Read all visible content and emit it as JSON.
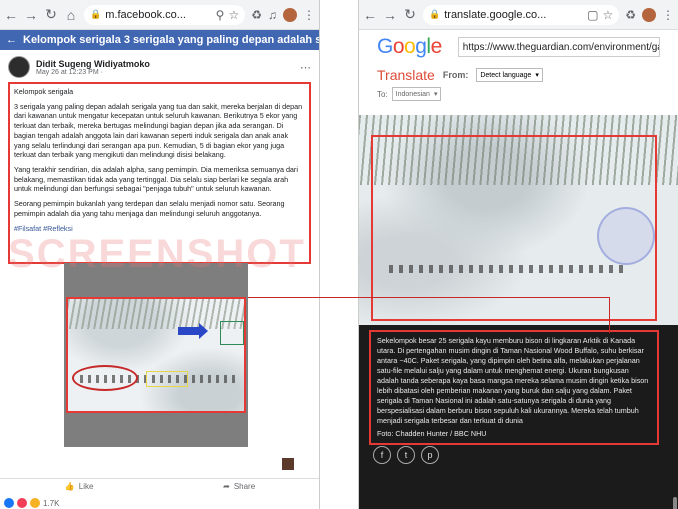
{
  "left": {
    "url": "m.facebook.co...",
    "page_title": "Kelompok serigala 3 serigala yang paling depan adalah ser...",
    "author": "Didit Sugeng Widiyatmoko",
    "meta": "May 26 at 12:23 PM ·",
    "post_paragraphs": [
      "Kelompok serigala",
      "3 serigala yang paling depan adalah serigala yang tua dan sakit, mereka berjalan di depan dari kawanan untuk mengatur kecepatan untuk seluruh kawanan. Berikutnya 5 ekor yang terkuat dan terbaik, mereka bertugas melindungi bagian depan jika ada serangan. Di bagian tengah adalah anggota lain dari kawanan seperti induk serigala dan anak anak yang selalu terlindungi dari serangan apa pun. Kemudian, 5 di bagian ekor yang juga terkuat dan terbaik yang mengikuti dan melindungi disisi belakang.",
      "Yang terakhir sendirian, dia adalah alpha, sang pemimpin. Dia memeriksa semuanya dari belakang, memastikan tidak ada yang tertinggal. Dia selalu siap berlari ke segala arah untuk melindungi dan berfungsi sebagai \"penjaga tubuh\" untuk seluruh kawanan.",
      "Seorang pemimpin bukanlah yang terdepan dan selalu menjadi nomor satu. Seorang pemimpin adalah dia yang tahu menjaga dan melindungi seluruh anggotanya."
    ],
    "hashtags": "#Filsafat #Refleksi",
    "like_label": "Like",
    "share_label": "Share",
    "reaction_count": "1.7K"
  },
  "watermark": "SCREENSHOT",
  "right": {
    "url": "translate.google.co...",
    "logo": "Google",
    "source_url": "https://www.theguardian.com/environment/galler",
    "translate_label": "Translate",
    "from_label": "From:",
    "from_value": "Detect language",
    "to_label": "To:",
    "to_value": "Indonesian",
    "caption": "Sekelompok besar 25 serigala kayu memburu bison di lingkaran Arktik di Kanada utara. Di pertengahan musim dingin di Taman Nasional Wood Buffalo, suhu berkisar antara −40C. Paket serigala, yang dipimpin oleh betina alfa, melakukan perjalanan satu-file melalui salju yang dalam untuk menghemat energi. Ukuran bungkusan adalah tanda seberapa kaya basa mangsa mereka selama musim dingin ketika bison lebih dibatasi oleh pemberian makanan yang buruk dan salju yang dalam. Paket serigala di Taman Nasional ini adalah satu-satunya serigala di dunia yang berspesialisasi dalam berburu bison sepuluh kali ukurannya. Mereka telah tumbuh menjadi serigala terbesar dan terkuat di dunia",
    "credit": "Foto: Chadden Hunter / BBC NHU",
    "socials": [
      "f",
      "t",
      "p"
    ]
  },
  "colors": {
    "facebook_blue": "#4267b2",
    "highlight_red": "#e53935",
    "translate_red": "#dd4b39"
  }
}
